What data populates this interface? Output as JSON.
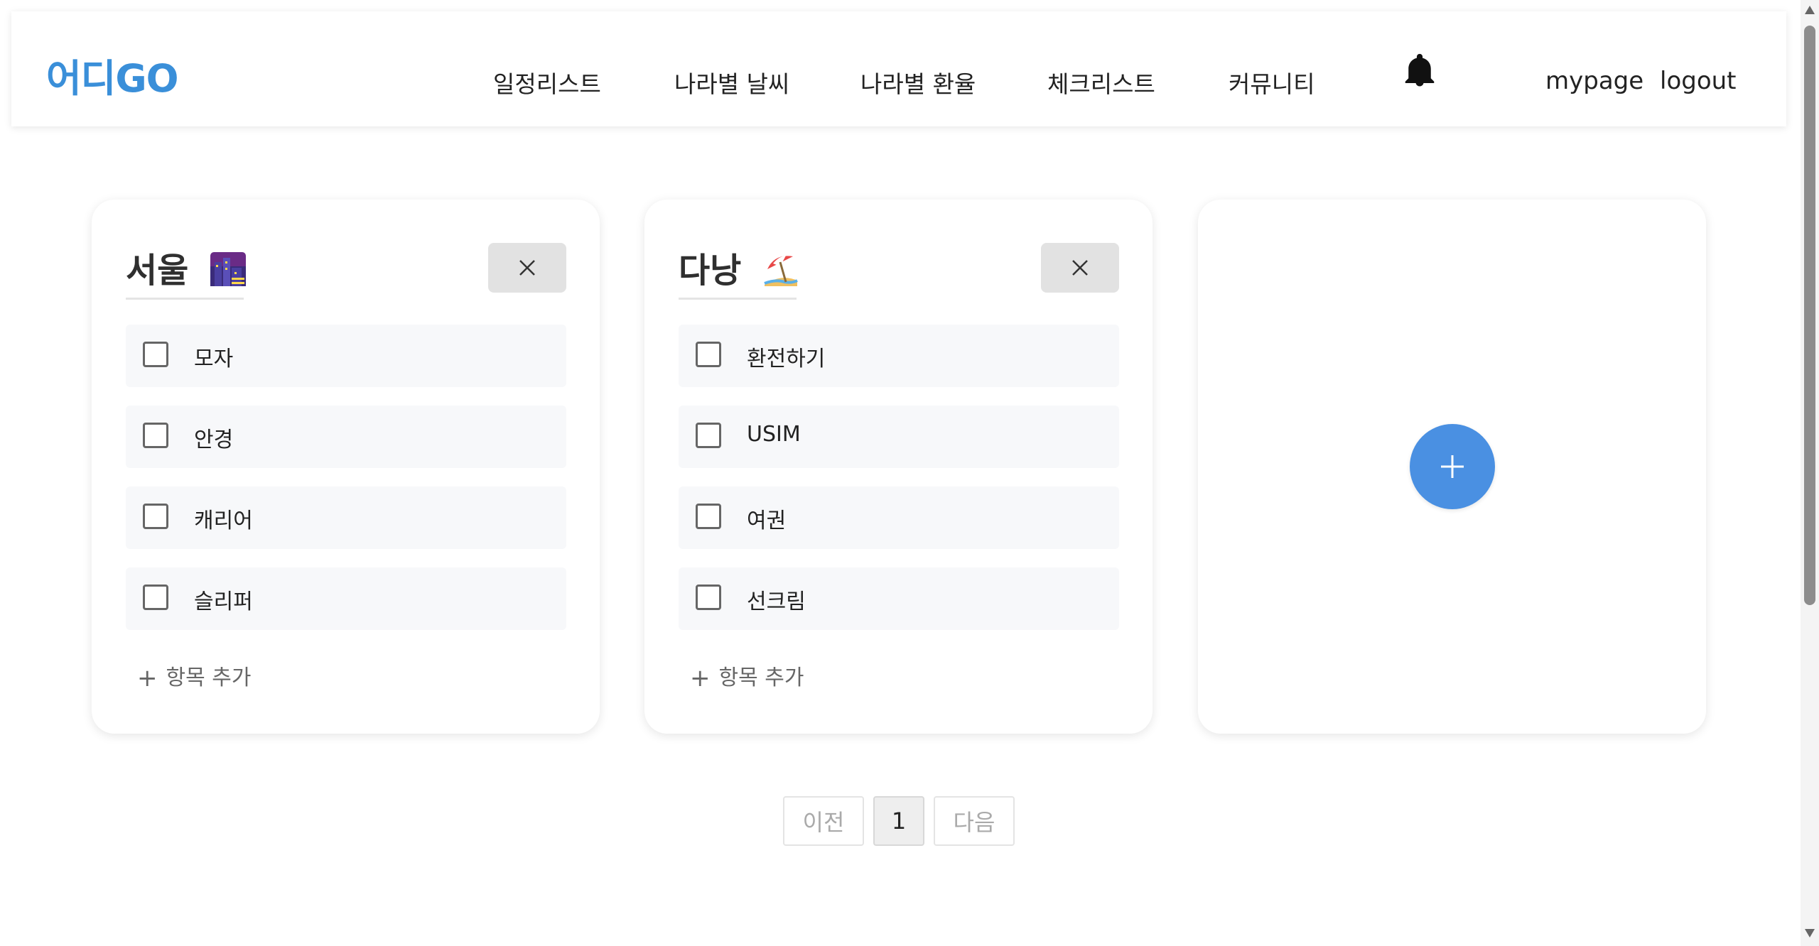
{
  "header": {
    "logo": "어디GO",
    "nav": [
      "일정리스트",
      "나라별 날씨",
      "나라별 환율",
      "체크리스트",
      "커뮤니티"
    ],
    "notification_icon": "bell-icon",
    "mypage": "mypage",
    "logout": "logout"
  },
  "checklists": [
    {
      "title": "서울",
      "emoji": "night-city-emoji",
      "items": [
        "모자",
        "안경",
        "캐리어",
        "슬리퍼"
      ],
      "add_label": "항목 추가"
    },
    {
      "title": "다낭",
      "emoji": "beach-umbrella-emoji",
      "items": [
        "환전하기",
        "USIM",
        "여권",
        "선크림"
      ],
      "add_label": "항목 추가"
    }
  ],
  "add_checklist_icon": "plus-icon",
  "pagination": {
    "prev": "이전",
    "current": "1",
    "next": "다음"
  },
  "colors": {
    "logo": "#3a8fd9",
    "add_button": "#4a90e2"
  }
}
